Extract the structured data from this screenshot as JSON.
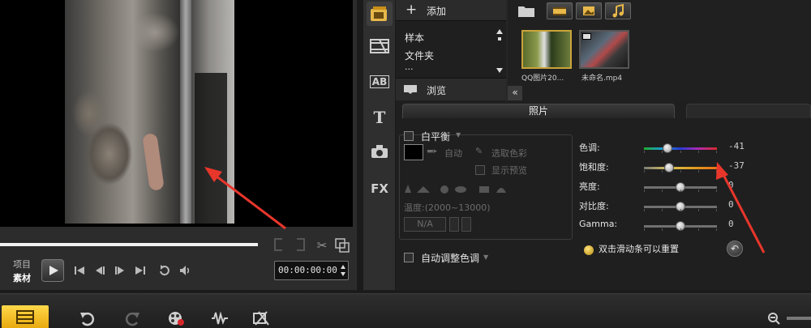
{
  "library": {
    "add_label": "添加",
    "folders": [
      "样本",
      "文件夹",
      "..."
    ],
    "browse_label": "浏览",
    "thumbnails": [
      {
        "label": "QQ图片20..."
      },
      {
        "label": "未命名.mp4"
      }
    ]
  },
  "preview": {
    "mode_project": "项目",
    "mode_clip": "素材",
    "timecode": "00:00:00:00"
  },
  "options": {
    "tab_photo": "照片",
    "white_balance": {
      "label": "白平衡",
      "auto": "自动",
      "pick_color": "选取色彩",
      "show_preview": "显示预览",
      "temperature_range": "温度:(2000~13000)",
      "temperature_value": "N/A"
    },
    "auto_tone": "自动调整色调",
    "adjustments": [
      {
        "label": "色调:",
        "value": "-41",
        "level": -41
      },
      {
        "label": "饱和度:",
        "value": "-37",
        "level": -37
      },
      {
        "label": "亮度:",
        "value": "0",
        "level": 0
      },
      {
        "label": "对比度:",
        "value": "0",
        "level": 0
      },
      {
        "label": "Gamma:",
        "value": "0",
        "level": 0
      }
    ],
    "reset_hint": "双击滑动条可以重置"
  },
  "side_tabs": [
    "media",
    "transition",
    "title-ab",
    "text-t",
    "graphic",
    "fx"
  ],
  "side_tab_labels": {
    "title": "AB",
    "text": "T",
    "fx": "FX"
  },
  "colors": {
    "accent": "#e8a80c",
    "annotation_arrow": "#e8362b"
  }
}
